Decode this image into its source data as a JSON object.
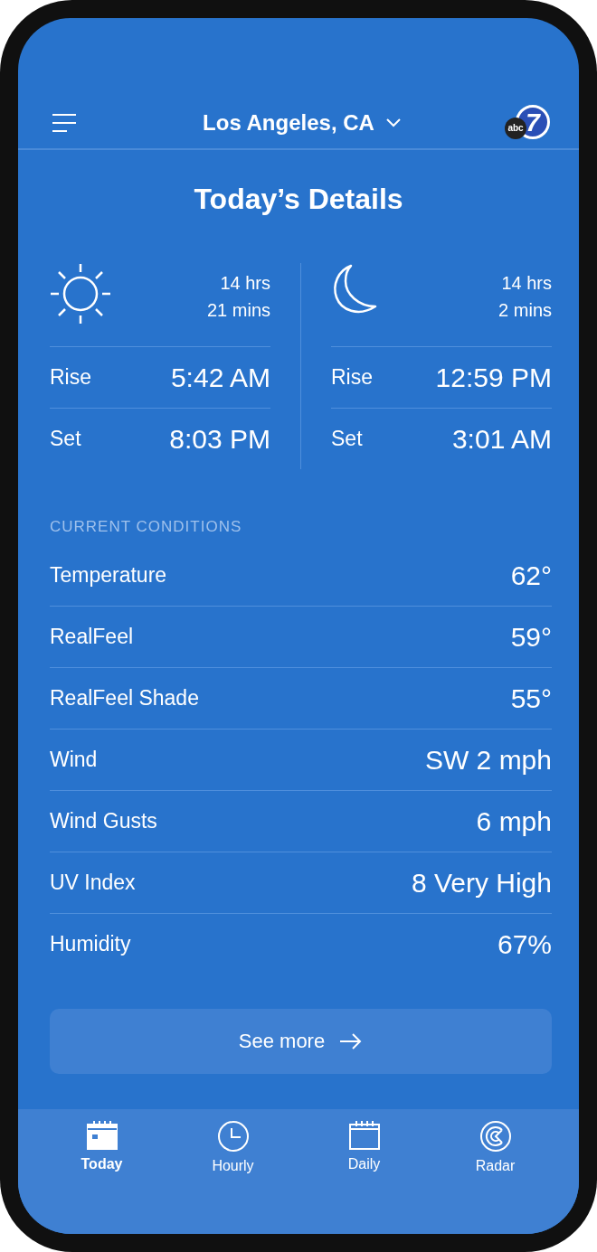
{
  "header": {
    "location": "Los Angeles, CA",
    "logo": {
      "badge": "abc",
      "number": "7"
    }
  },
  "title": "Today’s Details",
  "astro": [
    {
      "kind": "sun",
      "duration": [
        "14 hrs",
        "21 mins"
      ],
      "rows": [
        {
          "label": "Rise",
          "value": "5:42 AM"
        },
        {
          "label": "Set",
          "value": "8:03 PM"
        }
      ]
    },
    {
      "kind": "moon",
      "duration": [
        "14 hrs",
        "2 mins"
      ],
      "rows": [
        {
          "label": "Rise",
          "value": "12:59 PM"
        },
        {
          "label": "Set",
          "value": "3:01 AM"
        }
      ]
    }
  ],
  "conditions": {
    "heading": "CURRENT CONDITIONS",
    "rows": [
      {
        "label": "Temperature",
        "value": "62°"
      },
      {
        "label": "RealFeel",
        "value": "59°"
      },
      {
        "label": "RealFeel Shade",
        "value": "55°"
      },
      {
        "label": "Wind",
        "value": "SW 2 mph"
      },
      {
        "label": "Wind Gusts",
        "value": "6 mph"
      },
      {
        "label": "UV Index",
        "value": "8 Very High"
      },
      {
        "label": "Humidity",
        "value": "67%"
      }
    ]
  },
  "see_more": "See more",
  "tabs": [
    {
      "label": "Today",
      "kind": "today",
      "selected": true
    },
    {
      "label": "Hourly",
      "kind": "hourly",
      "selected": false
    },
    {
      "label": "Daily",
      "kind": "daily",
      "selected": false
    },
    {
      "label": "Radar",
      "kind": "radar",
      "selected": false
    }
  ]
}
